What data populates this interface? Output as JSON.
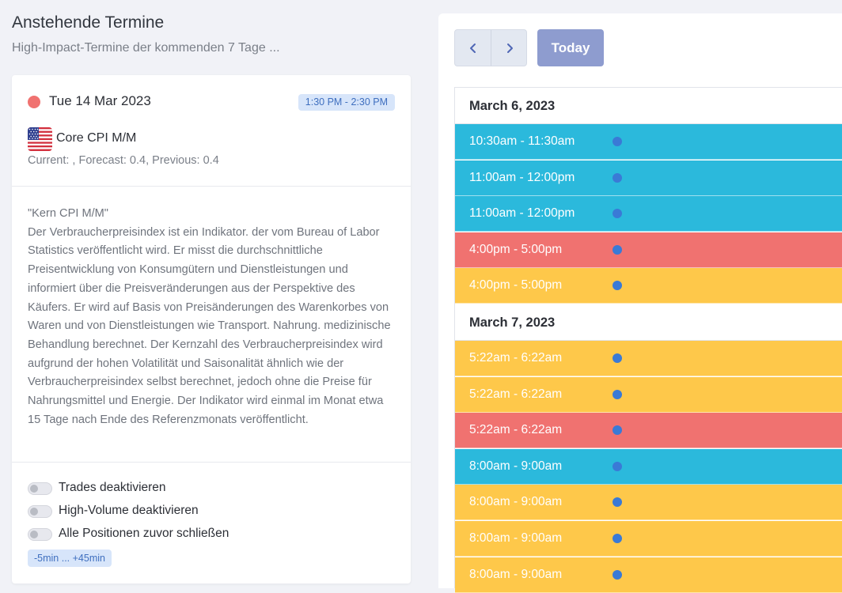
{
  "left_panel": {
    "title": "Anstehende Termine",
    "subtitle": "High-Impact-Termine der kommenden 7 Tage ..."
  },
  "event_card": {
    "date": "Tue 14 Mar 2023",
    "time_range": "1:30 PM - 2:30 PM",
    "status_color": "#f07270",
    "flag_icon": "us-flag-icon",
    "name": "Core CPI M/M",
    "values_line": "Current: , Forecast: 0.4, Previous: 0.4",
    "description": "\"Kern CPI M/M\"\nDer Verbraucherpreisindex ist ein Indikator. der vom Bureau of Labor Statistics veröffentlicht wird. Er misst die durchschnittliche Preisentwicklung von Konsumgütern und Dienstleistungen und informiert über die Preisveränderungen aus der Perspektive des Käufers. Er wird auf Basis von Preisänderungen des Warenkorbes von Waren und von Dienstleistungen wie Transport. Nahrung. medizinische Behandlung berechnet. Der Kernzahl des Verbraucherpreisindex wird aufgrund der hohen Volatilität und Saisonalität ähnlich wie der Verbraucherpreisindex selbst berechnet, jedoch ohne die Preise für Nahrungsmittel und Energie. Der Indikator wird einmal im Monat etwa 15 Tage nach Ende des Referenzmonats veröffentlicht.",
    "toggles": [
      {
        "label": "Trades deaktivieren",
        "on": false
      },
      {
        "label": "High-Volume deaktivieren",
        "on": false
      },
      {
        "label": "Alle Positionen zuvor schließen",
        "on": false
      }
    ],
    "range_badge": "-5min ... +45min"
  },
  "calendar": {
    "prev_icon": "chevron-left-icon",
    "next_icon": "chevron-right-icon",
    "today_label": "Today",
    "days": [
      {
        "label": "March 6, 2023",
        "events": [
          {
            "time": "10:30am - 11:30am",
            "color": "#2bb9dc"
          },
          {
            "time": "11:00am - 12:00pm",
            "color": "#2bb9dc"
          },
          {
            "time": "11:00am - 12:00pm",
            "color": "#2bb9dc"
          },
          {
            "time": "4:00pm - 5:00pm",
            "color": "#f07270"
          },
          {
            "time": "4:00pm - 5:00pm",
            "color": "#fec84a"
          }
        ]
      },
      {
        "label": "March 7, 2023",
        "events": [
          {
            "time": "5:22am - 6:22am",
            "color": "#fec84a"
          },
          {
            "time": "5:22am - 6:22am",
            "color": "#fec84a"
          },
          {
            "time": "5:22am - 6:22am",
            "color": "#f07270"
          },
          {
            "time": "8:00am - 9:00am",
            "color": "#2bb9dc"
          },
          {
            "time": "8:00am - 9:00am",
            "color": "#fec84a"
          },
          {
            "time": "8:00am - 9:00am",
            "color": "#fec84a"
          },
          {
            "time": "8:00am - 9:00am",
            "color": "#fec84a"
          }
        ]
      }
    ]
  }
}
